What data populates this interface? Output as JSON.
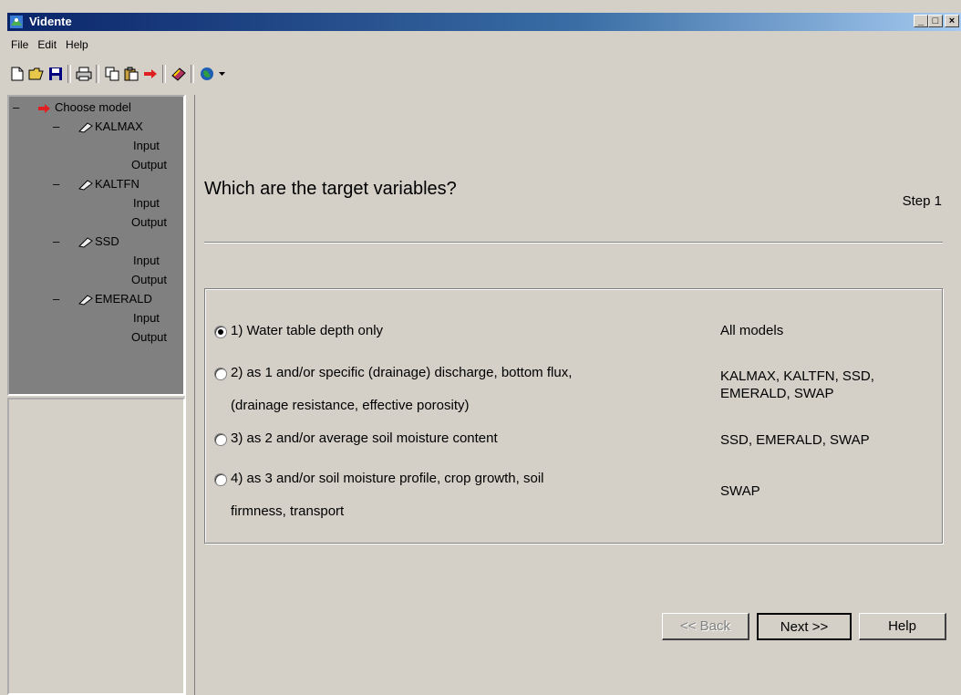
{
  "window": {
    "title": "Vidente",
    "min": "_",
    "max": "□",
    "close": "×"
  },
  "menu": [
    "File",
    "Edit",
    "Help"
  ],
  "toolbar": [
    "new-icon",
    "open-icon",
    "save-icon",
    "print-icon",
    "copy-icon",
    "paste-icon",
    "arrow-icon",
    "book-icon",
    "globe-icon"
  ],
  "tree": {
    "root": "Choose model",
    "models": [
      {
        "name": "KALMAX",
        "children": [
          "Input",
          "Output"
        ]
      },
      {
        "name": "KALTFN",
        "children": [
          "Input",
          "Output"
        ]
      },
      {
        "name": "SSD",
        "children": [
          "Input",
          "Output"
        ]
      },
      {
        "name": "EMERALD",
        "children": [
          "Input",
          "Output"
        ]
      }
    ]
  },
  "wizard": {
    "question": "Which are the target variables?",
    "step": "Step 1",
    "options": [
      {
        "lines": [
          "1) Water table depth only"
        ],
        "models": [
          "All models"
        ],
        "selected": true
      },
      {
        "lines": [
          "2) as 1 and/or specific (drainage) discharge, bottom flux,",
          "(drainage resistance, effective porosity)"
        ],
        "models": [
          "KALMAX, KALTFN, SSD,",
          "EMERALD, SWAP"
        ],
        "selected": false
      },
      {
        "lines": [
          "3) as 2 and/or average soil moisture content"
        ],
        "models": [
          "SSD, EMERALD, SWAP"
        ],
        "selected": false
      },
      {
        "lines": [
          "4) as 3 and/or soil moisture profile, crop growth, soil",
          "firmness, transport"
        ],
        "models": [
          "SWAP"
        ],
        "selected": false
      }
    ],
    "buttons": {
      "back": "<< Back",
      "next": "Next >>",
      "help": "Help"
    }
  }
}
